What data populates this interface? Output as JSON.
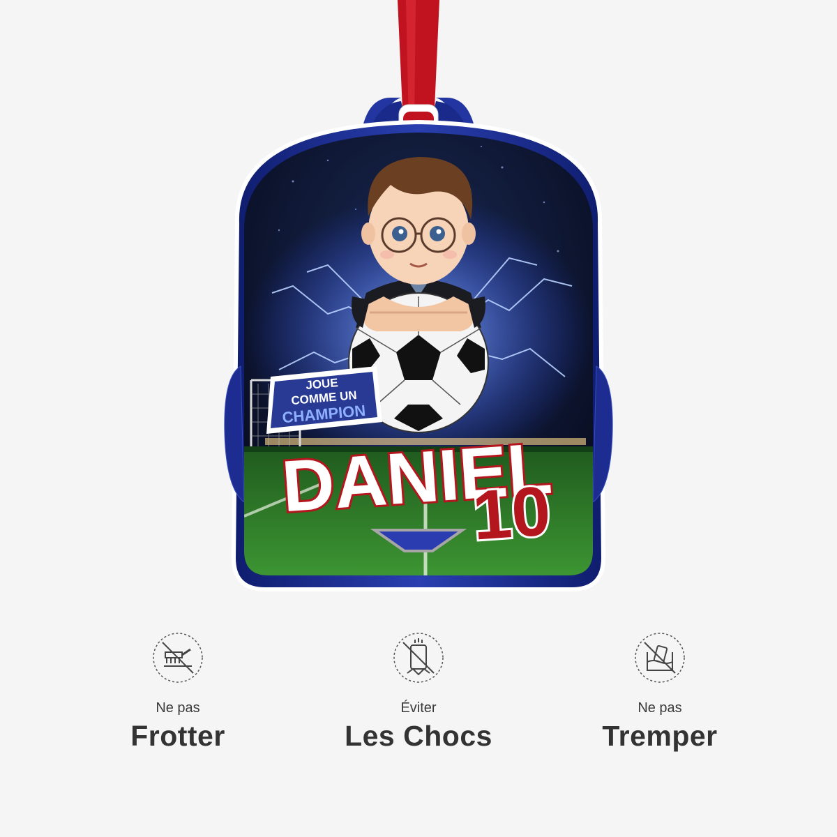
{
  "product": {
    "badge_line1": "JOUE",
    "badge_line2": "COMME UN",
    "badge_line3": "CHAMPION",
    "name": "DANIEL",
    "number": "10",
    "colors": {
      "ribbon": "#c1121f",
      "bag": "#1d2d8c",
      "name_fill": "#ffffff",
      "name_outline": "#b3161c",
      "number_fill": "#b3161c",
      "pitch": "#2f7d2a"
    }
  },
  "care": [
    {
      "icon": "no-scrubbing-icon",
      "small": "Ne pas",
      "big": "Frotter"
    },
    {
      "icon": "no-impact-icon",
      "small": "Éviter",
      "big": "Les Chocs"
    },
    {
      "icon": "no-soaking-icon",
      "small": "Ne pas",
      "big": "Tremper"
    }
  ]
}
